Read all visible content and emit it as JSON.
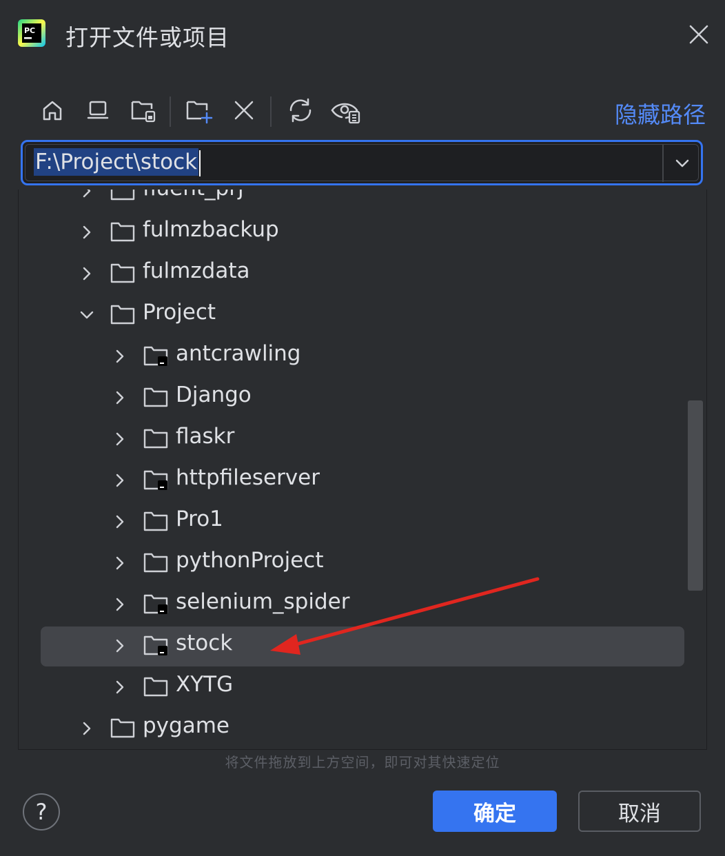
{
  "window": {
    "title": "打开文件或项目",
    "logo_text": "PC",
    "logo_icon": "pycharm-logo",
    "close_icon": "close-icon"
  },
  "toolbar": {
    "buttons": [
      {
        "icon": "home-icon"
      },
      {
        "icon": "desktop-icon"
      },
      {
        "icon": "project-folder-icon"
      },
      {
        "icon": "new-folder-icon"
      },
      {
        "icon": "delete-icon"
      },
      {
        "icon": "refresh-icon"
      },
      {
        "icon": "show-hidden-icon"
      }
    ],
    "hide_path_label": "隐藏路径"
  },
  "path": {
    "value": "F:\\Project\\stock"
  },
  "tree": {
    "rows": [
      {
        "label": "fluent_prj",
        "expanded": false,
        "level": 1,
        "module": false
      },
      {
        "label": "fulmzbackup",
        "expanded": false,
        "level": 1,
        "module": false
      },
      {
        "label": "fulmzdata",
        "expanded": false,
        "level": 1,
        "module": false
      },
      {
        "label": "Project",
        "expanded": true,
        "level": 1,
        "module": false
      },
      {
        "label": "antcrawling",
        "expanded": false,
        "level": 2,
        "module": true
      },
      {
        "label": "Django",
        "expanded": false,
        "level": 2,
        "module": false
      },
      {
        "label": "flaskr",
        "expanded": false,
        "level": 2,
        "module": false
      },
      {
        "label": "httpfileserver",
        "expanded": false,
        "level": 2,
        "module": true
      },
      {
        "label": "Pro1",
        "expanded": false,
        "level": 2,
        "module": false
      },
      {
        "label": "pythonProject",
        "expanded": false,
        "level": 2,
        "module": false
      },
      {
        "label": "selenium_spider",
        "expanded": false,
        "level": 2,
        "module": true
      },
      {
        "label": "stock",
        "expanded": false,
        "level": 2,
        "module": true,
        "selected": true
      },
      {
        "label": "XYTG",
        "expanded": false,
        "level": 2,
        "module": false
      },
      {
        "label": "pygame",
        "expanded": false,
        "level": 1,
        "module": false
      }
    ]
  },
  "hint": "将文件拖放到上方空间，即可对其快速定位",
  "footer": {
    "help_label": "?",
    "ok_label": "确定",
    "cancel_label": "取消"
  },
  "colors": {
    "accent": "#3574f0",
    "link": "#548af7",
    "annotation_arrow": "#e0261f"
  }
}
